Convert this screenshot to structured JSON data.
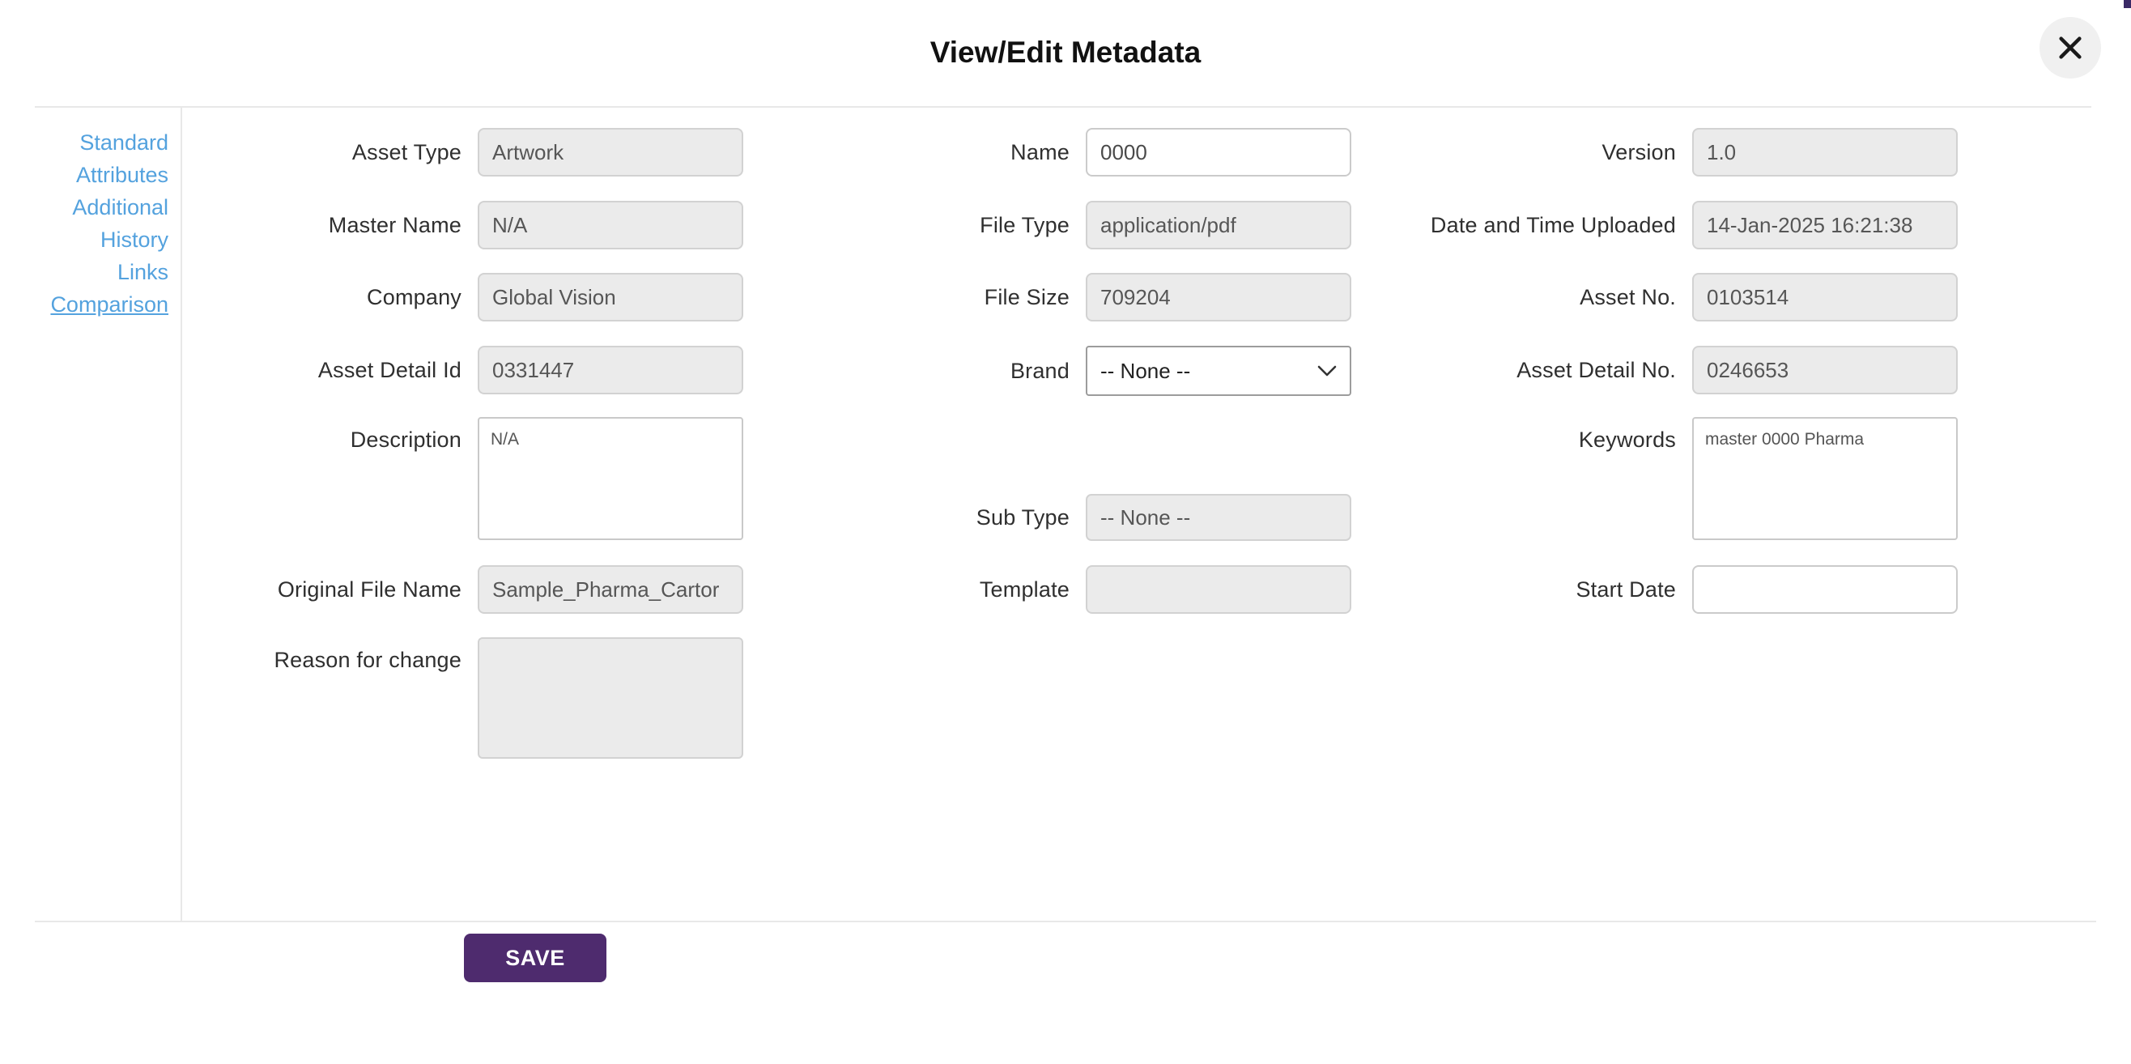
{
  "modal": {
    "title": "View/Edit Metadata"
  },
  "colors": {
    "accent_purple": "#4e2b6e",
    "link_blue": "#54a2de",
    "field_gray": "#ebebeb"
  },
  "sidebar": {
    "links": [
      {
        "label": "Standard"
      },
      {
        "label": "Attributes"
      },
      {
        "label": "Additional"
      },
      {
        "label": "History"
      },
      {
        "label": "Links"
      },
      {
        "label": "Comparison"
      }
    ]
  },
  "columns": {
    "left": {
      "asset_type": {
        "label": "Asset Type",
        "value": "Artwork"
      },
      "master_name": {
        "label": "Master Name",
        "value": "N/A"
      },
      "company": {
        "label": "Company",
        "value": "Global Vision"
      },
      "asset_detail_id": {
        "label": "Asset Detail Id",
        "value": "0331447"
      },
      "description": {
        "label": "Description",
        "value": "N/A"
      },
      "original_file_name": {
        "label": "Original File Name",
        "value": "Sample_Pharma_Cartor"
      },
      "reason_for_change": {
        "label": "Reason for change",
        "value": ""
      }
    },
    "middle": {
      "name": {
        "label": "Name",
        "value": "0000"
      },
      "file_type": {
        "label": "File Type",
        "value": "application/pdf"
      },
      "file_size": {
        "label": "File Size",
        "value": "709204"
      },
      "brand": {
        "label": "Brand",
        "value": "-- None --"
      },
      "sub_type": {
        "label": "Sub Type",
        "value": "-- None --"
      },
      "template": {
        "label": "Template",
        "value": ""
      }
    },
    "right": {
      "version": {
        "label": "Version",
        "value": "1.0"
      },
      "date_uploaded": {
        "label": "Date and Time Uploaded",
        "value": "14-Jan-2025 16:21:38"
      },
      "asset_no": {
        "label": "Asset No.",
        "value": "0103514"
      },
      "asset_detail_no": {
        "label": "Asset Detail No.",
        "value": "0246653"
      },
      "keywords": {
        "label": "Keywords",
        "value": "master 0000 Pharma"
      },
      "start_date": {
        "label": "Start Date",
        "value": ""
      }
    }
  },
  "footer": {
    "save_label": "SAVE"
  }
}
